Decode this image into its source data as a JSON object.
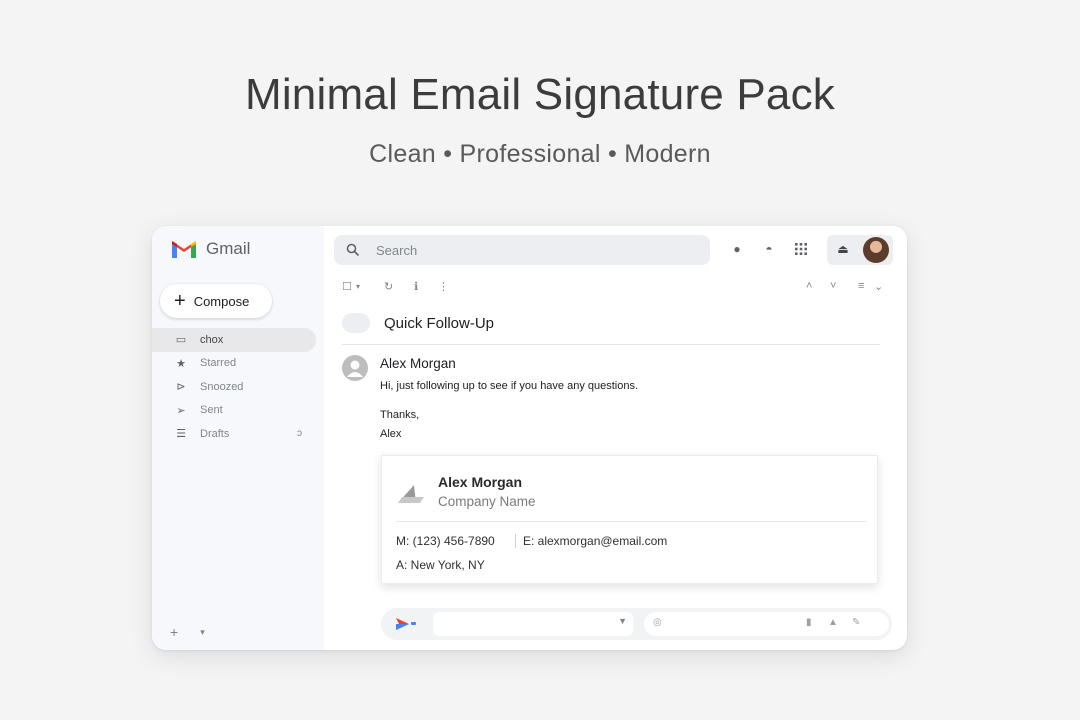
{
  "hero": {
    "title": "Minimal Email Signature Pack",
    "subtitle": "Clean • Professional • Modern"
  },
  "app": {
    "name": "Gmail",
    "search_placeholder": "Search"
  },
  "sidebar": {
    "compose_label": "Compose",
    "items": [
      {
        "label": "chox",
        "icon": "inbox-icon",
        "active": true,
        "count": ""
      },
      {
        "label": "Starred",
        "icon": "star-icon",
        "active": false,
        "count": ""
      },
      {
        "label": "Snoozed",
        "icon": "snoozed-icon",
        "active": false,
        "count": ""
      },
      {
        "label": "Sent",
        "icon": "sent-icon",
        "active": false,
        "count": ""
      },
      {
        "label": "Drafts",
        "icon": "drafts-icon",
        "active": false,
        "count": "ɔ"
      }
    ]
  },
  "email": {
    "subject": "Quick Follow-Up",
    "sender": "Alex Morgan",
    "body": [
      "Hi, just following up to see if you have any questions.",
      "Thanks,",
      "Alex"
    ]
  },
  "signature": {
    "name": "Alex Morgan",
    "company": "Company Name",
    "mobile": "M: (123) 456-7890",
    "email": "E: alexmorgan@email.com",
    "address": "A: New York, NY"
  },
  "colors": {
    "page_background": "#f4f4f5",
    "sidebar_background": "#f6f8fc",
    "gmail_red": "#ea4335",
    "gmail_blue": "#4285f4",
    "gmail_yellow": "#fbbc04",
    "gmail_green": "#34a853"
  }
}
